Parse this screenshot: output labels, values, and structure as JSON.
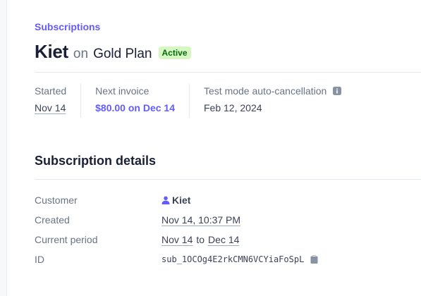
{
  "breadcrumb": "Subscriptions",
  "header": {
    "customer_name": "Kiet",
    "on_word": "on",
    "plan_name": "Gold Plan",
    "status": "Active"
  },
  "summary": {
    "started_label": "Started",
    "started_value": "Nov 14",
    "next_invoice_label": "Next invoice",
    "next_invoice_value": "$80.00 on Dec 14",
    "auto_cancel_label": "Test mode auto-cancellation",
    "auto_cancel_value": "Feb 12, 2024"
  },
  "details": {
    "section_title": "Subscription details",
    "customer_label": "Customer",
    "customer_value": "Kiet",
    "created_label": "Created",
    "created_value": "Nov 14, 10:37 PM",
    "period_label": "Current period",
    "period_start": "Nov 14",
    "period_to": "to",
    "period_end": "Dec 14",
    "id_label": "ID",
    "id_value": "sub_1OCOg4E2rkCMN6VCYiaFoSpL"
  },
  "icons": {
    "info": "info-icon",
    "person": "person-icon",
    "copy": "clipboard-icon"
  },
  "colors": {
    "accent": "#635bff",
    "badge_bg": "#d7f7c2",
    "badge_text": "#05690d",
    "muted_text": "#697386"
  }
}
